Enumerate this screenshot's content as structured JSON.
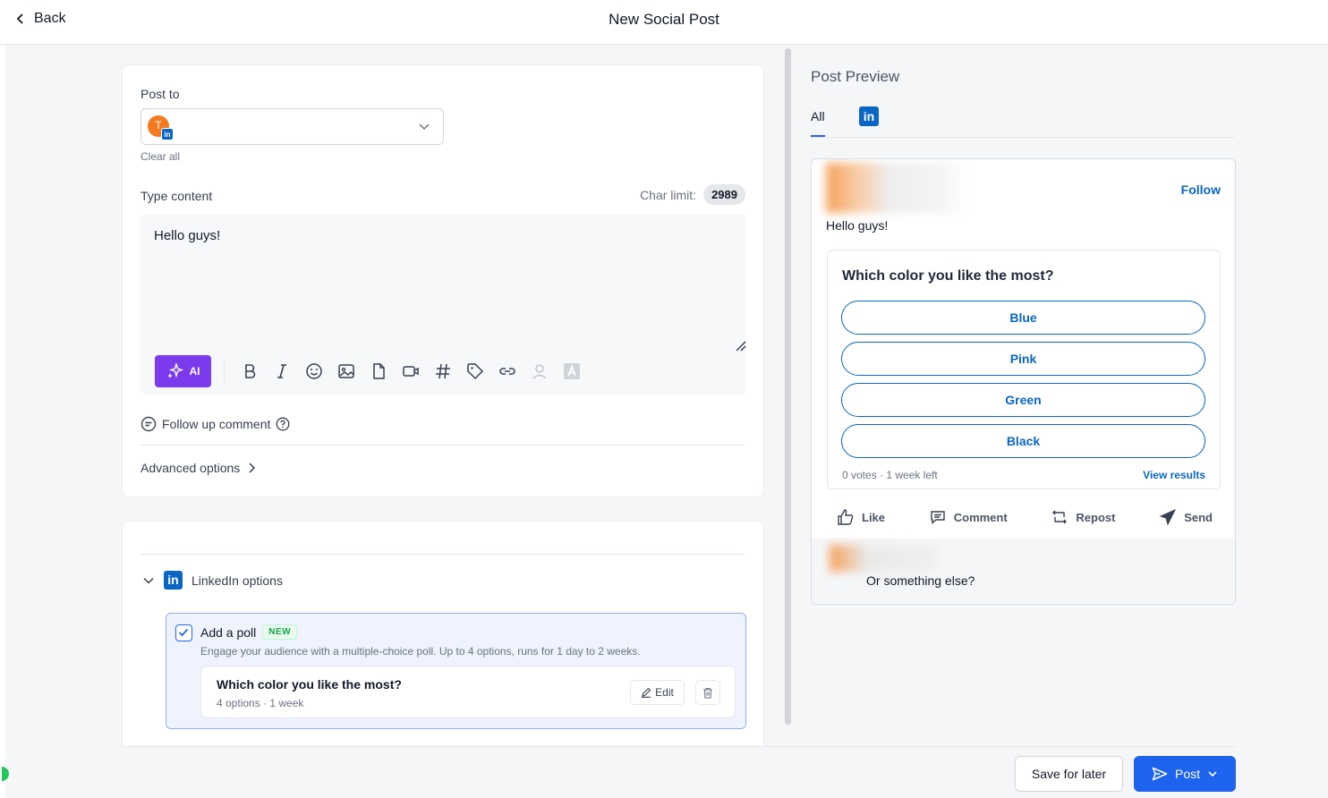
{
  "header": {
    "back_label": "Back",
    "title": "New Social Post"
  },
  "compose": {
    "post_to_label": "Post to",
    "account_avatar_initial": "T",
    "account_network_badge": "in",
    "clear_all_label": "Clear all",
    "type_content_label": "Type content",
    "char_limit_label": "Char limit:",
    "char_limit_value": "2989",
    "content_text": "Hello guys!",
    "ai_label": "AI",
    "toolbar_icons": [
      "bold-icon",
      "italic-icon",
      "emoji-icon",
      "image-icon",
      "document-icon",
      "video-icon",
      "hashtag-icon",
      "tag-icon",
      "link-icon",
      "mention-icon",
      "text-format-icon"
    ],
    "follow_up_label": "Follow up comment",
    "advanced_label": "Advanced options"
  },
  "linkedin": {
    "section_label": "LinkedIn options",
    "logo_text": "in",
    "poll": {
      "checked": true,
      "title": "Add a poll",
      "badge": "NEW",
      "description": "Engage your audience with a multiple-choice poll. Up to 4 options, runs for 1 day to 2 weeks.",
      "question": "Which color you like the most?",
      "meta": "4 options · 1 week",
      "edit_label": "Edit"
    }
  },
  "preview": {
    "title": "Post Preview",
    "tab_all": "All",
    "tab_linkedin": "in",
    "follow_label": "Follow",
    "text": "Hello guys!",
    "poll_question": "Which color you like the most?",
    "poll_options": [
      "Blue",
      "Pink",
      "Green",
      "Black"
    ],
    "votes": "0 votes · 1 week left",
    "view_results": "View results",
    "actions": {
      "like": "Like",
      "comment": "Comment",
      "repost": "Repost",
      "send": "Send"
    },
    "comment_text": "Or something else?"
  },
  "footer": {
    "save_label": "Save for later",
    "post_label": "Post"
  },
  "colors": {
    "accent": "#1d63ed",
    "ai": "#7c3aed",
    "linkedin": "#0a66c2",
    "new_badge": "#16a34a"
  }
}
